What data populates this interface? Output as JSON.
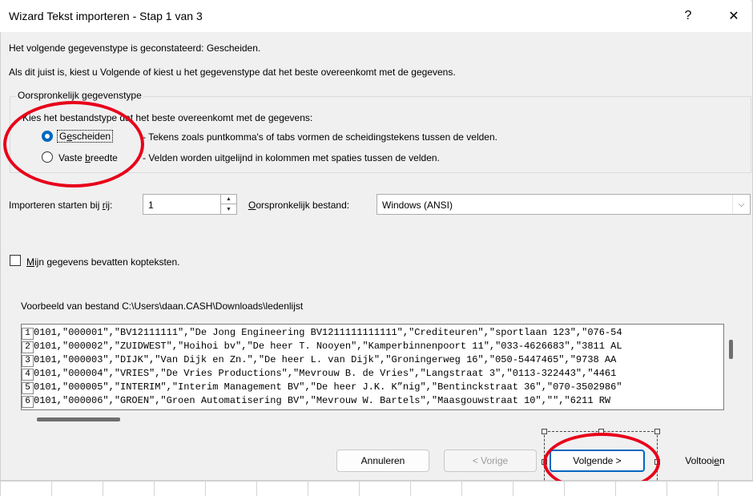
{
  "window": {
    "title": "Wizard Tekst importeren - Stap 1 van 3",
    "help_glyph": "?",
    "close_glyph": "✕"
  },
  "intro": {
    "line1": "Het volgende gegevenstype is geconstateerd: Gescheiden.",
    "line2": "Als dit juist is, kiest u Volgende of kiest u het gegevenstype dat het beste overeenkomt met de gegevens."
  },
  "data_type_group": {
    "legend": "Oorspronkelijk gegevenstype",
    "prompt": "Kies het bestandstype dat het beste overeenkomt met de gegevens:",
    "options": [
      {
        "label_pre": "G",
        "label_u": "e",
        "label_post": "scheiden",
        "description": "- Tekens zoals puntkomma's of tabs vormen de scheidingstekens tussen de velden.",
        "selected": true
      },
      {
        "label_pre": "Vaste ",
        "label_u": "b",
        "label_post": "reedte",
        "description": "- Velden worden uitgelijnd in kolommen met spaties tussen de velden.",
        "selected": false
      }
    ]
  },
  "start_row": {
    "label_pre": "Importeren starten bij ",
    "label_u": "r",
    "label_post": "ij:",
    "value": "1"
  },
  "origin": {
    "label_u": "O",
    "label_post": "orspronkelijk bestand:",
    "value": "Windows (ANSI)"
  },
  "headers_checkbox": {
    "label_u": "M",
    "label_post": "ijn gegevens bevatten kopteksten.",
    "checked": false
  },
  "preview": {
    "label": "Voorbeeld van bestand C:\\Users\\daan.CASH\\Downloads\\ledenlijst",
    "lines": [
      {
        "n": "1",
        "text": "0101,\"000001\",\"BV12111111\",\"De Jong Engineering BV1211111111111\",\"Crediteuren\",\"sportlaan 123\",\"076-54"
      },
      {
        "n": "2",
        "text": "0101,\"000002\",\"ZUIDWEST\",\"Hoihoi bv\",\"De heer T. Nooyen\",\"Kamperbinnenpoort 11\",\"033-4626683\",\"3811 AL"
      },
      {
        "n": "3",
        "text": "0101,\"000003\",\"DIJK\",\"Van Dijk en Zn.\",\"De heer L. van Dijk\",\"Groningerweg 16\",\"050-5447465\",\"9738 AA"
      },
      {
        "n": "4",
        "text": "0101,\"000004\",\"VRIES\",\"De Vries Productions\",\"Mevrouw B. de Vries\",\"Langstraat 3\",\"0113-322443\",\"4461"
      },
      {
        "n": "5",
        "text": "0101,\"000005\",\"INTERIM\",\"Interim Management BV\",\"De heer J.K. K”nig\",\"Bentinckstraat 36\",\"070-3502986\""
      },
      {
        "n": "6",
        "text": "0101,\"000006\",\"GROEN\",\"Groen Automatisering BV\",\"Mevrouw W. Bartels\",\"Maasgouwstraat 10\",\"\",\"6211 RW"
      }
    ]
  },
  "buttons": {
    "cancel": "Annuleren",
    "back": "< Vorige",
    "next_pre": "Vol",
    "next_u": "g",
    "next_post": "ende >",
    "finish_pre": "Voltooi",
    "finish_u": "e",
    "finish_post": "n"
  },
  "colors": {
    "annotation": "#e8001a",
    "accent": "#0067c0"
  }
}
